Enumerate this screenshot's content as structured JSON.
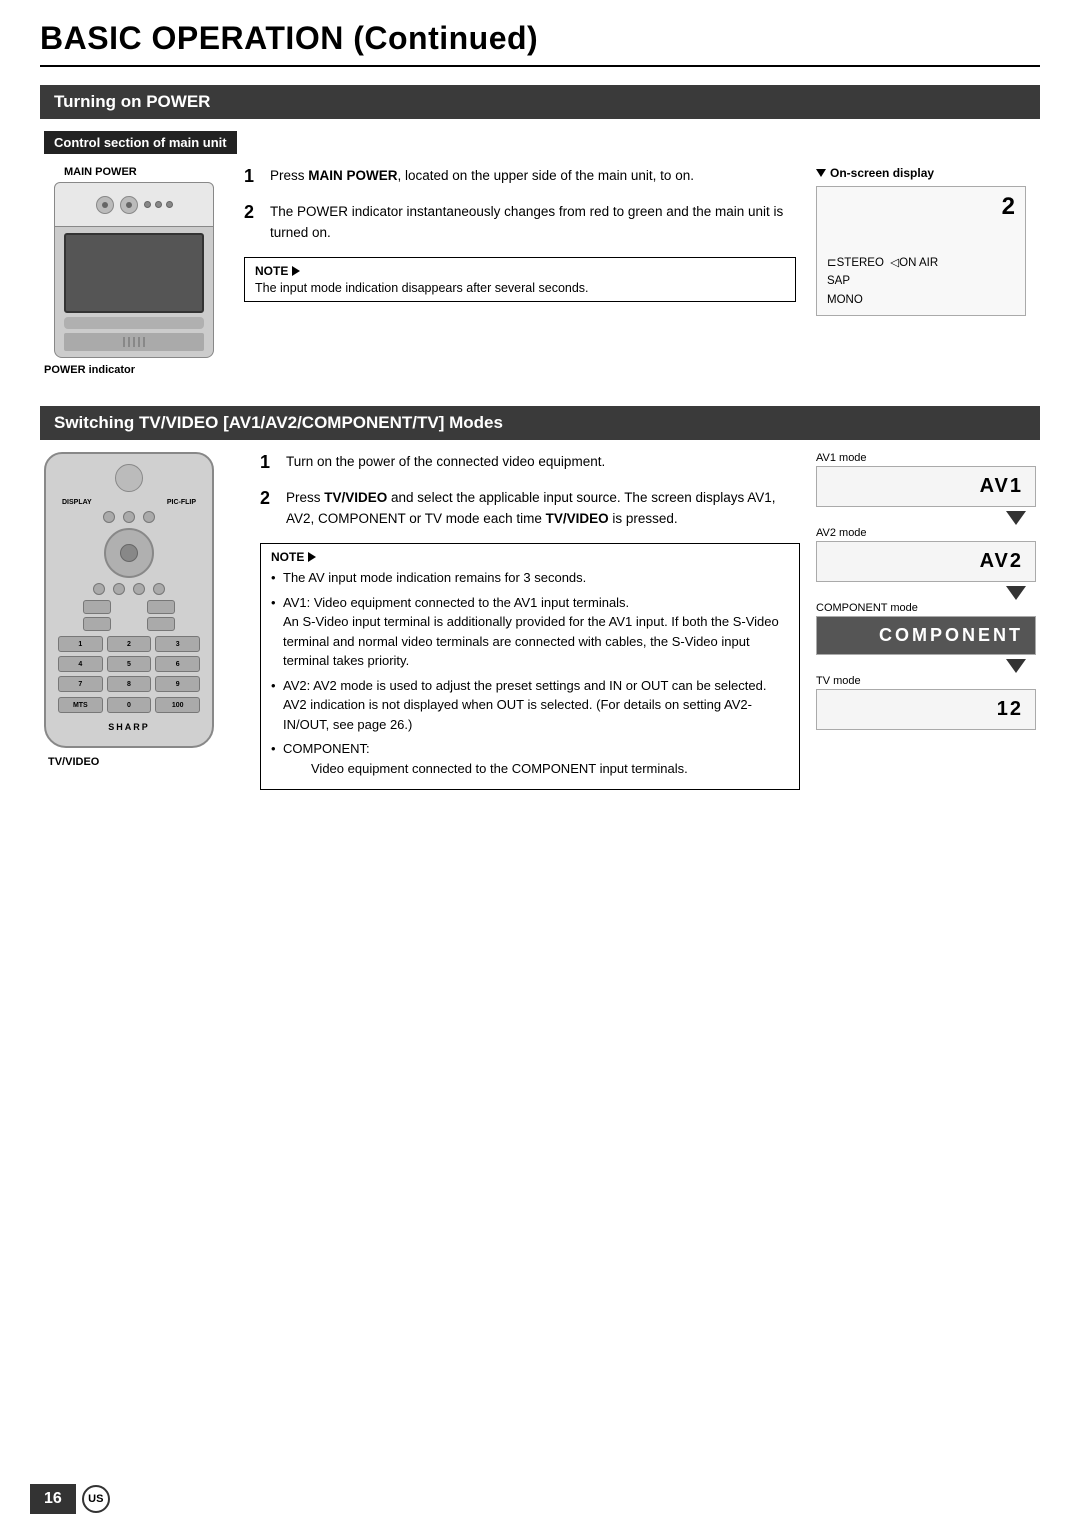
{
  "page": {
    "title": "BASIC OPERATION (Continued)",
    "page_number": "16",
    "locale": "US"
  },
  "section1": {
    "header": "Turning on POWER",
    "sub_label": "Control section of main unit",
    "main_power_label": "MAIN POWER",
    "power_indicator_label": "POWER indicator",
    "steps": [
      {
        "num": "1",
        "text_parts": [
          {
            "bold": true,
            "text": "MAIN POWER"
          },
          {
            "bold": false,
            "text": ", located on the upper side of the main unit, to on."
          },
          {
            "prefix": "Press ",
            "bold_word": "MAIN POWER"
          }
        ],
        "full_text": "Press MAIN POWER, located on the upper side of the main unit, to on."
      },
      {
        "num": "2",
        "full_text": "The POWER indicator instantaneously changes from red to green and the main unit is turned on."
      }
    ],
    "note_label": "NOTE",
    "note_text": "The input mode indication disappears after several seconds.",
    "onscreen_display_label": "On-screen display",
    "onscreen_number": "2",
    "onscreen_lines": [
      "⊏STEREO  ◁ON AIR",
      "SAP",
      "MONO"
    ]
  },
  "section2": {
    "header": "Switching TV/VIDEO [AV1/AV2/COMPONENT/TV] Modes",
    "steps": [
      {
        "num": "1",
        "full_text": "Turn on the power of the connected video equipment."
      },
      {
        "num": "2",
        "full_text_parts": [
          {
            "bold": false,
            "text": "Press "
          },
          {
            "bold": true,
            "text": "TV/VIDEO"
          },
          {
            "bold": false,
            "text": " and select the applicable input source. The screen displays AV1, AV2, COMPONENT or TV mode each time "
          },
          {
            "bold": true,
            "text": "TV/VIDEO"
          },
          {
            "bold": false,
            "text": " is pressed."
          }
        ]
      }
    ],
    "tv_video_label": "TV/VIDEO",
    "note_label": "NOTE",
    "note_bullets": [
      "The AV input mode indication remains for 3 seconds.",
      "AV1: Video equipment connected to the AV1 input terminals. An S-Video input terminal is additionally provided for the AV1 input. If both the S-Video terminal and normal video terminals are connected with cables, the S-Video input terminal takes priority.",
      "AV2: AV2 mode is used to adjust the preset settings and IN or OUT can be selected. AV2 indication is not displayed when OUT is selected. (For details on setting AV2-IN/OUT, see page 26.)",
      "COMPONENT: Video equipment connected to the COMPONENT input terminals."
    ],
    "modes": [
      {
        "label": "AV1 mode",
        "display": "AV1",
        "has_arrow": true,
        "dark": false
      },
      {
        "label": "AV2 mode",
        "display": "AV2",
        "has_arrow": true,
        "dark": false
      },
      {
        "label": "COMPONENT mode",
        "display": "COMPONENT",
        "has_arrow": true,
        "dark": true
      },
      {
        "label": "TV mode",
        "display": "12",
        "has_arrow": false,
        "dark": false
      }
    ],
    "remote_sharp_logo": "SHARP",
    "remote_display_label": "DISPLAY",
    "remote_flip_label": "PIC-FLIP"
  }
}
